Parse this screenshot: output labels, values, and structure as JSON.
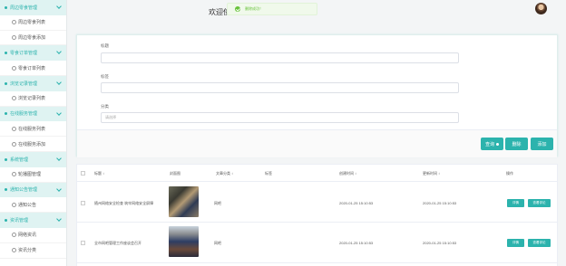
{
  "sidebar": {
    "items": [
      {
        "type": "group",
        "label": "周边零食管理"
      },
      {
        "type": "item",
        "label": "周边零食列表"
      },
      {
        "type": "item",
        "label": "周边零食添加"
      },
      {
        "type": "group",
        "label": "零食订单管理"
      },
      {
        "type": "item",
        "label": "零食订单列表"
      },
      {
        "type": "group",
        "label": "浏览记录管理"
      },
      {
        "type": "item",
        "label": "浏览记录列表"
      },
      {
        "type": "group",
        "label": "在线服务管理"
      },
      {
        "type": "item",
        "label": "在线服务列表"
      },
      {
        "type": "item",
        "label": "在线服务添加"
      },
      {
        "type": "group",
        "label": "系统管理"
      },
      {
        "type": "item",
        "label": "轮播图管理"
      },
      {
        "type": "group",
        "label": "通知公告管理"
      },
      {
        "type": "item",
        "label": "通知公告"
      },
      {
        "type": "group",
        "label": "资讯管理"
      },
      {
        "type": "item",
        "label": "网络资讯"
      },
      {
        "type": "item",
        "label": "资讯分类"
      }
    ]
  },
  "header": {
    "welcome": "欢迎使",
    "toast": "删除成功！"
  },
  "form": {
    "title_label": "标题",
    "tag_label": "标签",
    "category_label": "分类",
    "category_placeholder": "请选择",
    "query_label": "查询",
    "delete_label": "删除",
    "add_label": "添加"
  },
  "table": {
    "headers": {
      "title": "标题",
      "cover": "封面图",
      "category": "文章分类",
      "tag": "标签",
      "created": "创建时间",
      "updated": "更新时间",
      "action": "操作"
    },
    "rows": [
      {
        "title": "随州网络安全检查 筑牢网络安全屏障",
        "category": "网吧",
        "tag": "",
        "created": "2020-01-25 15:10:53",
        "updated": "2020-01-25 15:10:53",
        "detail": "详情",
        "comment": "查看评论"
      },
      {
        "title": "全市网吧管理工作座谈会召开",
        "category": "网吧",
        "tag": "",
        "created": "2020-01-25 15:10:53",
        "updated": "2020-01-25 15:10:53",
        "detail": "详情",
        "comment": "查看评论"
      }
    ]
  },
  "colors": {
    "accent": "#2cb3ad",
    "group_bg": "#dff3f2",
    "toast_green": "#67c23a"
  }
}
